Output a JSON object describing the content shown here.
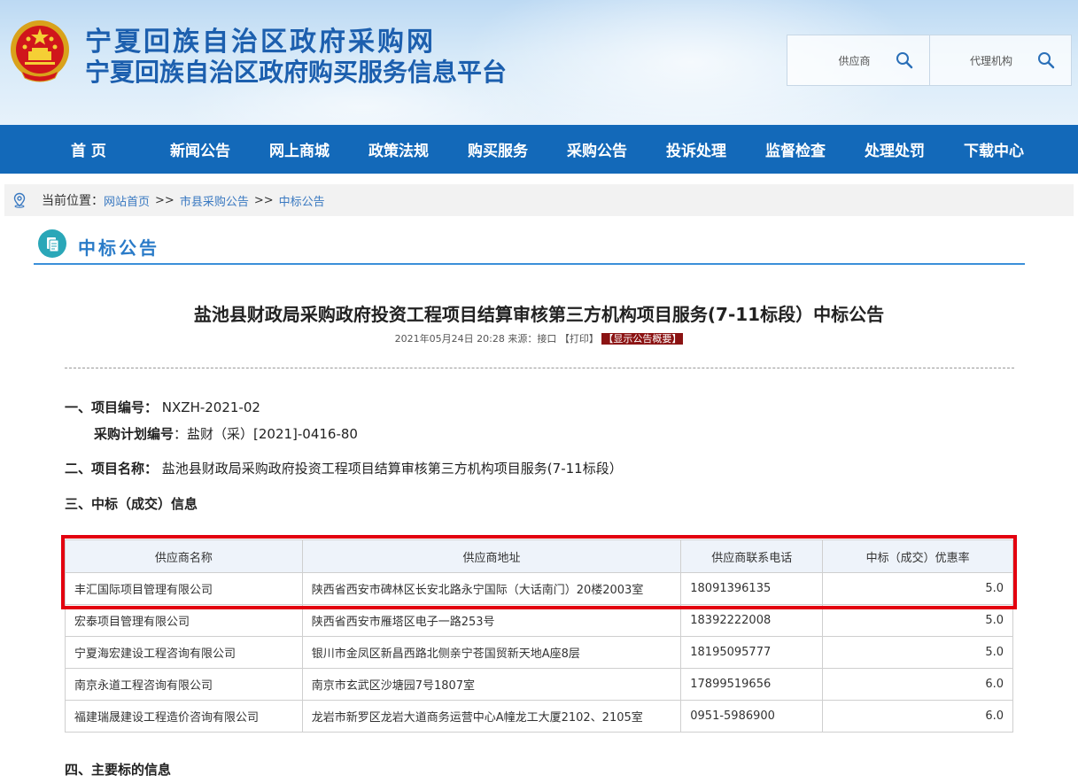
{
  "header": {
    "title": "宁夏回族自治区政府采购网",
    "subtitle": "宁夏回族自治区政府购买服务信息平台",
    "search": [
      {
        "label": "供应商"
      },
      {
        "label": "代理机构"
      }
    ]
  },
  "nav": [
    "首 页",
    "新闻公告",
    "网上商城",
    "政策法规",
    "购买服务",
    "采购公告",
    "投诉处理",
    "监督检查",
    "处理处罚",
    "下载中心"
  ],
  "breadcrumb": {
    "prefix": "当前位置：",
    "home": "网站首页",
    "sep1": ">>",
    "level1": "市县采购公告",
    "sep2": ">>",
    "level2": "中标公告"
  },
  "section_title": "中标公告",
  "doc": {
    "title": "盐池县财政局采购政府投资工程项目结算审核第三方机构项目服务(7-11标段）中标公告",
    "date": "2021年05月24日 20:28 来源：接口",
    "print": "【打印】",
    "summary": "【显示公告概要】"
  },
  "info": {
    "item1_label": "一、项目编号：",
    "item1_value": "NXZH-2021-02",
    "plan_label": "采购计划编号",
    "plan_value": "：盐财（采）[2021]-0416-80",
    "item2_label": "二、项目名称：",
    "item2_value": "盐池县财政局采购政府投资工程项目结算审核第三方机构项目服务(7-11标段）",
    "item3_label": "三、中标（成交）信息",
    "item4_label": "四、主要标的信息"
  },
  "table": {
    "headers": [
      "供应商名称",
      "供应商地址",
      "供应商联系电话",
      "中标（成交）优惠率"
    ],
    "rows": [
      [
        "丰汇国际项目管理有限公司",
        "陕西省西安市碑林区长安北路永宁国际（大话南门）20楼2003室",
        "18091396135",
        "5.0"
      ],
      [
        "宏泰项目管理有限公司",
        "陕西省西安市雁塔区电子一路253号",
        "18392222008",
        "5.0"
      ],
      [
        "宁夏海宏建设工程咨询有限公司",
        "银川市金凤区新昌西路北侧亲宁苍国贸新天地A座8层",
        "18195095777",
        "5.0"
      ],
      [
        "南京永道工程咨询有限公司",
        "南京市玄武区沙塘园7号1807室",
        "17899519656",
        "6.0"
      ],
      [
        "福建瑞晟建设工程造价咨询有限公司",
        "龙岩市新罗区龙岩大道商务运营中心A幢龙工大厦2102、2105室",
        "0951-5986900",
        "6.0"
      ]
    ]
  }
}
